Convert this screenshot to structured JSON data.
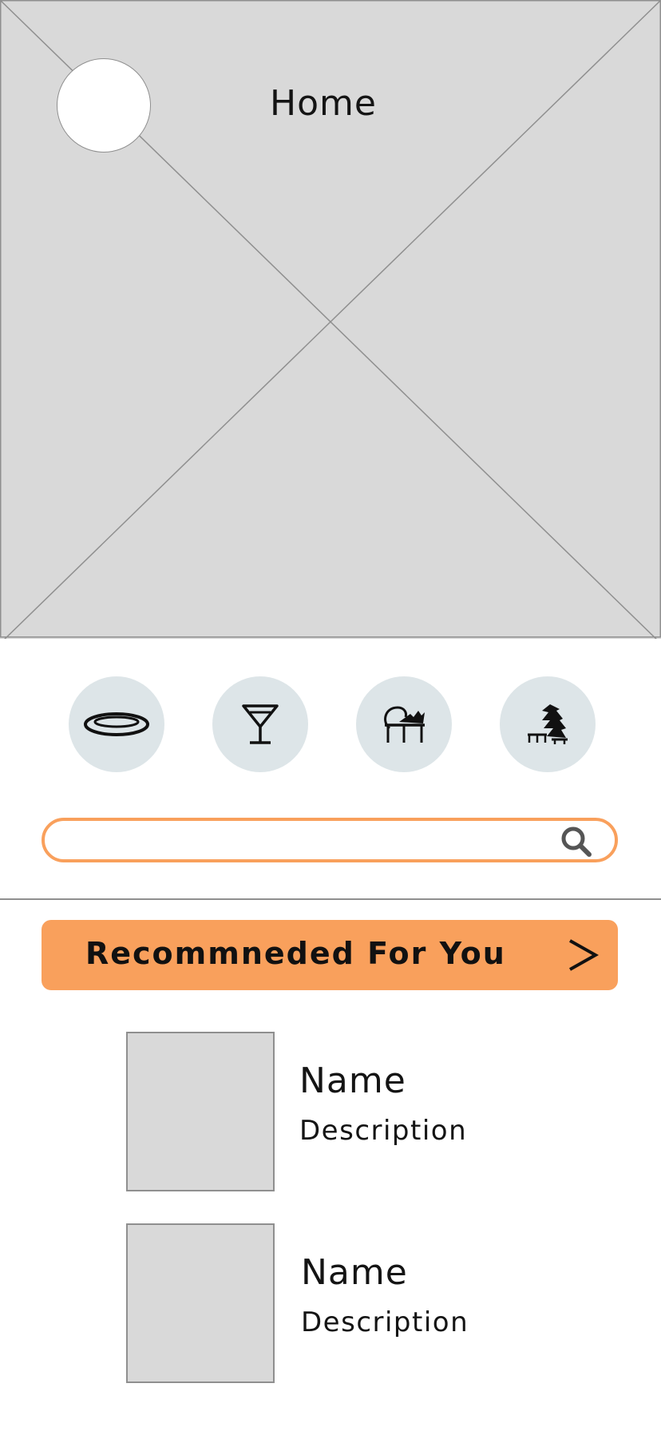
{
  "header": {
    "title": "Home"
  },
  "categories": [
    {
      "icon": "plate-icon"
    },
    {
      "icon": "cocktail-glass-icon"
    },
    {
      "icon": "dining-table-icon"
    },
    {
      "icon": "outdoor-bench-tree-icon"
    }
  ],
  "search": {
    "placeholder": "",
    "value": "",
    "icon": "search-icon"
  },
  "recommended": {
    "label": "Recommneded For You",
    "arrow": ">"
  },
  "items": [
    {
      "name": "Name",
      "description": "Description"
    },
    {
      "name": "Name",
      "description": "Description"
    }
  ],
  "colors": {
    "accent": "#f9a05c",
    "placeholder_gray": "#d9d9d9",
    "category_bg": "#dde5e8"
  }
}
